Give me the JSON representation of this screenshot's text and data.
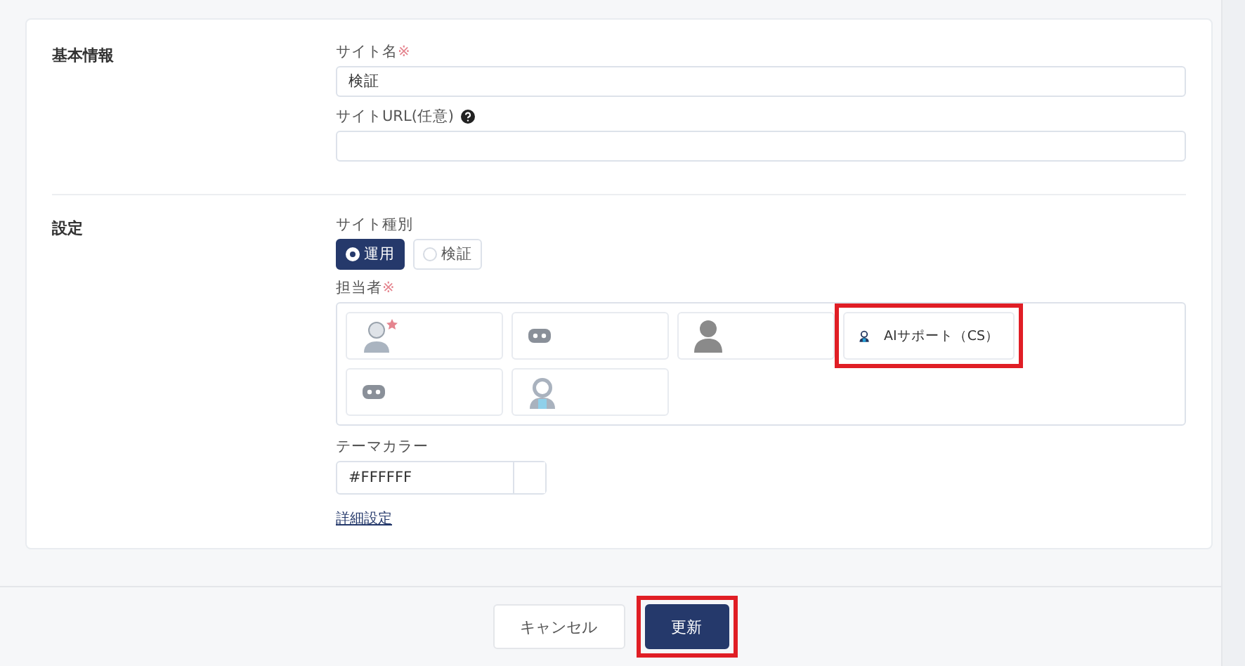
{
  "sections": [
    {
      "kind": "basic",
      "heading": "基本情報",
      "site_name": {
        "label": "サイト名",
        "required_mark": "※",
        "value": "検証"
      },
      "site_url": {
        "label": "サイトURL(任意)",
        "help": true
      }
    },
    {
      "kind": "settings",
      "heading": "設定",
      "site_type": {
        "label": "サイト種別",
        "options": [
          {
            "label": "運用",
            "selected": true
          },
          {
            "label": "検証",
            "selected": false
          }
        ]
      },
      "assignees": {
        "label": "担当者",
        "required_mark": "※",
        "items": [
          {
            "kind": "man",
            "favorite": true,
            "highlighted": false
          },
          {
            "kind": "bot",
            "favorite": false,
            "highlighted": false
          },
          {
            "kind": "person",
            "favorite": false,
            "highlighted": false
          },
          {
            "kind": "woman",
            "name": "AIサポート（CS）",
            "favorite": false,
            "highlighted": true
          },
          {
            "kind": "bot",
            "favorite": false,
            "highlighted": false
          },
          {
            "kind": "woman_light",
            "favorite": false,
            "highlighted": false
          }
        ]
      },
      "theme_color": {
        "label": "テーマカラー",
        "value": "#FFFFFF"
      },
      "advanced_link": "詳細設定"
    }
  ],
  "footer": {
    "buttons": [
      {
        "kind": "secondary",
        "label": "キャンセル",
        "highlighted": false
      },
      {
        "kind": "primary",
        "label": "更新",
        "highlighted": true
      }
    ]
  }
}
